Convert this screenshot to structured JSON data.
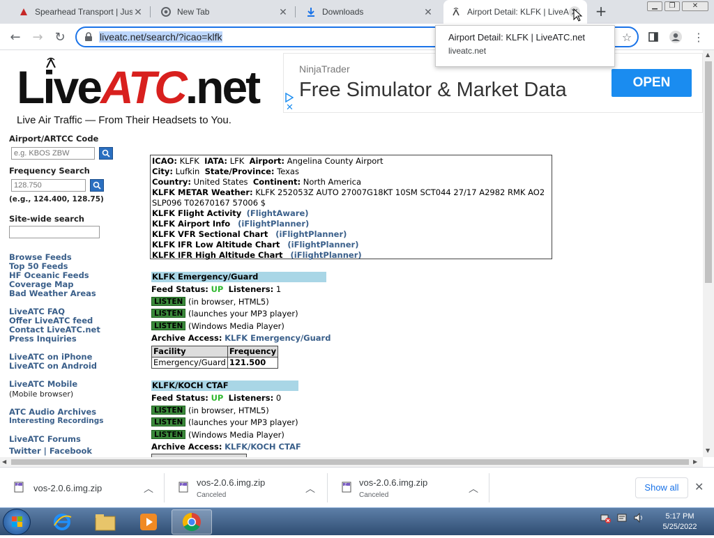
{
  "browser": {
    "tabs": [
      {
        "title": "Spearhead Transport | Just",
        "favicon": "spearhead-icon"
      },
      {
        "title": "New Tab",
        "favicon": "chrome-icon"
      },
      {
        "title": "Downloads",
        "favicon": "download-icon"
      },
      {
        "title": "Airport Detail: KLFK | LiveA",
        "favicon": "liveatc-icon",
        "active": true
      }
    ],
    "url": "liveatc.net/search/?icao=klfk",
    "tooltip": {
      "title": "Airport Detail: KLFK | LiveATC.net",
      "domain": "liveatc.net"
    }
  },
  "logo": {
    "live": "Live",
    "atc": "ATC",
    "net": ".net",
    "tagline": "Live Air Traffic — From Their Headsets to You."
  },
  "ad": {
    "brand": "NinjaTrader",
    "headline": "Free Simulator & Market Data",
    "cta": "OPEN",
    "close": "✕"
  },
  "sidebar": {
    "airport_label": "Airport/ARTCC Code",
    "airport_placeholder": "e.g. KBOS ZBW",
    "freq_label": "Frequency Search",
    "freq_placeholder": "128.750",
    "freq_example": "(e.g., 124.400, 128.75)",
    "site_search_label": "Site-wide search",
    "links_group1": [
      "Browse Feeds",
      "Top 50 Feeds",
      "HF Oceanic Feeds",
      "Coverage Map",
      "Bad Weather Areas"
    ],
    "links_group2": [
      "LiveATC FAQ",
      "Offer LiveATC feed",
      "Contact LiveATC.net",
      "Press Inquiries"
    ],
    "links_group3": [
      "LiveATC on iPhone",
      "LiveATC on Android"
    ],
    "mobile_link": "LiveATC Mobile",
    "mobile_note": "(Mobile browser)",
    "archives_link": "ATC Audio Archives",
    "recordings_link": "Interesting Recordings",
    "forums_link": "LiveATC Forums",
    "social": "Twitter | Facebook"
  },
  "airport": {
    "icao_label": "ICAO:",
    "icao": "KLFK",
    "iata_label": "IATA:",
    "iata": "LFK",
    "airport_label": "Airport:",
    "airport": "Angelina County Airport",
    "city_label": "City:",
    "city": "Lufkin",
    "state_label": "State/Province:",
    "state": "Texas",
    "country_label": "Country:",
    "country": "United States",
    "continent_label": "Continent:",
    "continent": "North America",
    "metar_label": "KLFK METAR Weather:",
    "metar": "KLFK 252053Z AUTO 27007G18KT 10SM SCT044 27/17 A2982 RMK AO2 SLP096 T02670167 57006 $",
    "rows": [
      {
        "label": "KLFK Flight Activity",
        "link": "(FlightAware)"
      },
      {
        "label": "KLFK Airport Info",
        "link": "(iFlightPlanner)"
      },
      {
        "label": "KLFK VFR Sectional Chart",
        "link": "(iFlightPlanner)"
      },
      {
        "label": "KLFK IFR Low Altitude Chart",
        "link": "(iFlightPlanner)"
      },
      {
        "label": "KLFK IFR High Altitude Chart",
        "link": "(iFlightPlanner)"
      }
    ]
  },
  "feeds": [
    {
      "title": "KLFK Emergency/Guard",
      "status_label": "Feed Status:",
      "status": "UP",
      "listeners_label": "Listeners:",
      "listeners": "1",
      "listen": "LISTEN",
      "options": [
        "(in browser, HTML5)",
        "(launches your MP3 player)",
        "(Windows Media Player)"
      ],
      "archive_label": "Archive Access:",
      "archive_link": "KLFK Emergency/Guard",
      "table_headers": [
        "Facility",
        "Frequency"
      ],
      "table_rows": [
        [
          "Emergency/Guard",
          "121.500"
        ]
      ]
    },
    {
      "title": "KLFK/KOCH CTAF",
      "status_label": "Feed Status:",
      "status": "UP",
      "listeners_label": "Listeners:",
      "listeners": "0",
      "listen": "LISTEN",
      "options": [
        "(in browser, HTML5)",
        "(launches your MP3 player)",
        "(Windows Media Player)"
      ],
      "archive_label": "Archive Access:",
      "archive_link": "KLFK/KOCH CTAF"
    }
  ],
  "downloads": [
    {
      "name": "vos-2.0.6.img.zip",
      "status": ""
    },
    {
      "name": "vos-2.0.6.img.zip",
      "status": "Canceled"
    },
    {
      "name": "vos-2.0.6.img.zip",
      "status": "Canceled"
    }
  ],
  "show_all": "Show all",
  "clock": {
    "time": "5:17 PM",
    "date": "5/25/2022"
  }
}
